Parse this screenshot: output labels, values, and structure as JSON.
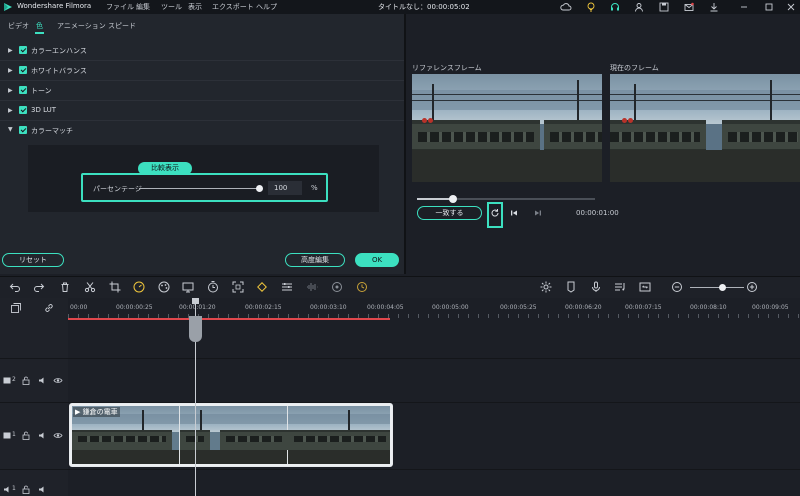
{
  "app": {
    "name": "Wondershare Filmora",
    "menu": [
      "ファイル",
      "編集",
      "ツール",
      "表示",
      "エクスポート",
      "ヘルプ"
    ],
    "doc_title": "タイトルなし：00:00:05:02"
  },
  "left": {
    "tabs": [
      "ビデオ",
      "色",
      "アニメーション",
      "スピード"
    ],
    "sections": [
      "カラーエンハンス",
      "ホワイトバランス",
      "トーン",
      "3D LUT",
      "カラーマッチ"
    ],
    "compare_label": "比較表示",
    "percentage_label": "パーセンテージ",
    "percentage_value": "100",
    "percentage_unit": "%",
    "percentage_level": 1.0,
    "reset_label": "リセット",
    "advanced_label": "高度編集",
    "ok_label": "OK"
  },
  "preview": {
    "reference_label": "リファレンスフレーム",
    "current_label": "現在のフレーム",
    "match_label": "一致する",
    "time": "00:00:01:00",
    "scrub_progress": 0.2
  },
  "timeline": {
    "ruler_labels": [
      "00:00",
      "00:00:00:25",
      "00:00:01:20",
      "00:00:02:15",
      "00:00:03:10",
      "00:00:04:05",
      "00:00:05:00",
      "00:00:05:25",
      "00:00:06:20",
      "00:00:07:15",
      "00:00:08:10",
      "00:00:09:05"
    ],
    "tracks": [
      {
        "label": "2"
      },
      {
        "label": "1"
      },
      {
        "label": "1"
      }
    ],
    "clip_title": "鎌倉の電車"
  },
  "colors": {
    "accent": "#3ce0c0",
    "ruler_marker": "#e0474c"
  }
}
